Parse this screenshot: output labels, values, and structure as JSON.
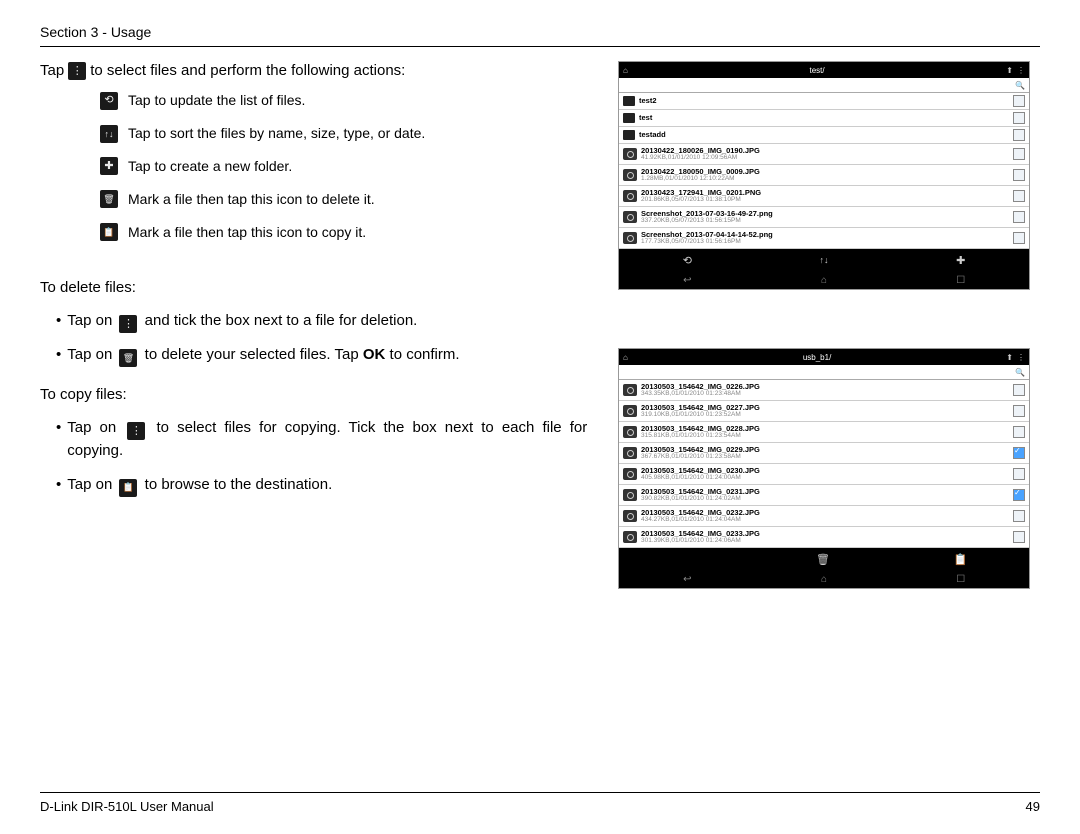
{
  "header": "Section 3 - Usage",
  "intro": {
    "prefix": "Tap",
    "suffix": "to select files and perform the following actions:"
  },
  "actions": [
    {
      "icon": "refresh",
      "text": "Tap to update the list of files."
    },
    {
      "icon": "sort",
      "text": "Tap to sort the files by name, size, type, or date."
    },
    {
      "icon": "newfolder",
      "text": "Tap to create a new folder."
    },
    {
      "icon": "trash",
      "text": "Mark a file then tap this icon to delete it."
    },
    {
      "icon": "copy",
      "text": "Mark a file then tap this icon to copy it."
    }
  ],
  "delete_section": {
    "title": "To delete files:",
    "b1_pre": "Tap on",
    "b1_post": "and tick the box next to a file for deletion.",
    "b2_pre": "Tap on",
    "b2_mid": "to delete your selected files. Tap",
    "b2_bold": "OK",
    "b2_post": "to confirm."
  },
  "copy_section": {
    "title": "To copy files:",
    "b1_pre": "Tap on",
    "b1_post": "to select files for copying. Tick the box next to each file for copying.",
    "b2_pre": "Tap on",
    "b2_post": "to browse to the destination."
  },
  "mock1": {
    "title": "test/",
    "folders": [
      "test2",
      "test",
      "testadd"
    ],
    "files": [
      {
        "name": "20130422_180026_IMG_0190.JPG",
        "meta": "41.92KB,01/01/2010 12:09:56AM"
      },
      {
        "name": "20130422_180050_IMG_0009.JPG",
        "meta": "1.28MB,01/01/2010 12:10:22AM"
      },
      {
        "name": "20130423_172941_IMG_0201.PNG",
        "meta": "201.86KB,05/07/2013 01:38:10PM"
      },
      {
        "name": "Screenshot_2013-07-03-16-49-27.png",
        "meta": "337.20KB,05/07/2013 01:56:15PM"
      },
      {
        "name": "Screenshot_2013-07-04-14-14-52.png",
        "meta": "177.73KB,05/07/2013 01:56:16PM"
      }
    ],
    "toolbar": [
      "refresh",
      "sort",
      "newfolder"
    ]
  },
  "mock2": {
    "title": "usb_b1/",
    "files": [
      {
        "name": "20130503_154642_IMG_0226.JPG",
        "meta": "343.35KB,01/01/2010 01:23:48AM",
        "checked": false
      },
      {
        "name": "20130503_154642_IMG_0227.JPG",
        "meta": "319.10KB,01/01/2010 01:23:52AM",
        "checked": false
      },
      {
        "name": "20130503_154642_IMG_0228.JPG",
        "meta": "315.81KB,01/01/2010 01:23:54AM",
        "checked": false
      },
      {
        "name": "20130503_154642_IMG_0229.JPG",
        "meta": "367.67KB,01/01/2010 01:23:58AM",
        "checked": true
      },
      {
        "name": "20130503_154642_IMG_0230.JPG",
        "meta": "405.98KB,01/01/2010 01:24:00AM",
        "checked": false
      },
      {
        "name": "20130503_154642_IMG_0231.JPG",
        "meta": "390.82KB,01/01/2010 01:24:02AM",
        "checked": true
      },
      {
        "name": "20130503_154642_IMG_0232.JPG",
        "meta": "434.27KB,01/01/2010 01:24:04AM",
        "checked": false
      },
      {
        "name": "20130503_154642_IMG_0233.JPG",
        "meta": "301.39KB,01/01/2010 01:24:06AM",
        "checked": false
      }
    ],
    "toolbar": [
      "trash",
      "copy"
    ]
  },
  "footer": {
    "left": "D-Link DIR-510L User Manual",
    "right": "49"
  },
  "glyphs": {
    "menu": "⋮",
    "refresh": "⟲",
    "sort": "↑↓",
    "newfolder": "✚",
    "trash": "🗑",
    "copy": "📋",
    "home": "⌂",
    "up": "⬆",
    "search": "🔍",
    "back": "↩",
    "recent": "☐"
  }
}
